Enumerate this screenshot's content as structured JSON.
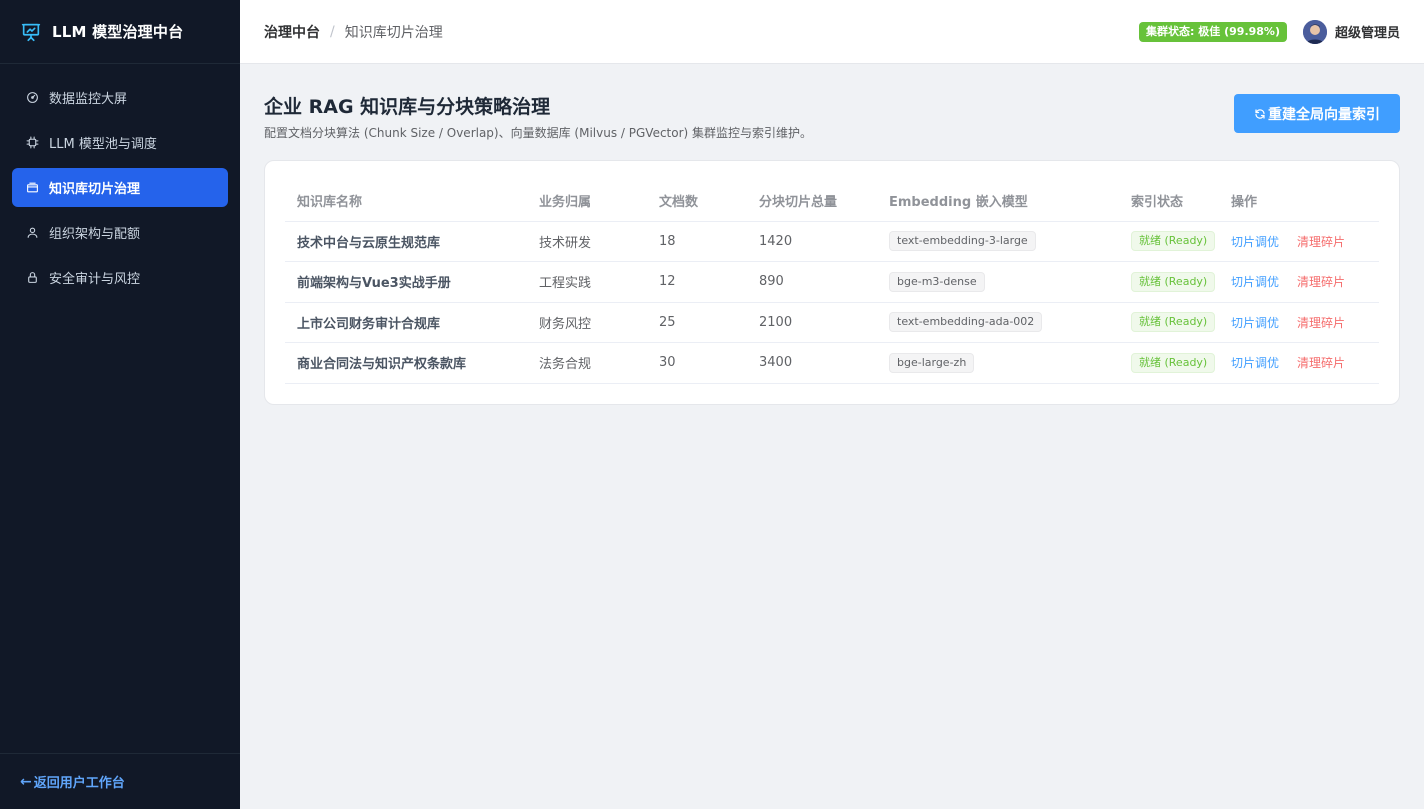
{
  "sidebar": {
    "brand": "LLM 模型治理中台",
    "items": [
      {
        "label": "数据监控大屏",
        "icon": "dashboard-icon",
        "active": false
      },
      {
        "label": "LLM 模型池与调度",
        "icon": "cpu-icon",
        "active": false
      },
      {
        "label": "知识库切片治理",
        "icon": "box-icon",
        "active": true
      },
      {
        "label": "组织架构与配额",
        "icon": "user-icon",
        "active": false
      },
      {
        "label": "安全审计与风控",
        "icon": "lock-icon",
        "active": false
      }
    ],
    "back_label": "返回用户工作台",
    "back_arrow": "←"
  },
  "header": {
    "breadcrumb_root": "治理中台",
    "breadcrumb_sep": "/",
    "breadcrumb_current": "知识库切片治理",
    "cluster_status": "集群状态: 极佳 (99.98%)",
    "user_name": "超级管理员"
  },
  "page": {
    "title": "企业 RAG 知识库与分块策略治理",
    "description": "配置文档分块算法 (Chunk Size / Overlap)、向量数据库 (Milvus / PGVector) 集群监控与索引维护。",
    "rebuild_button": "重建全局向量索引"
  },
  "table": {
    "columns": [
      "知识库名称",
      "业务归属",
      "文档数",
      "分块切片总量",
      "Embedding 嵌入模型",
      "索引状态",
      "操作"
    ],
    "rows": [
      {
        "name": "技术中台与云原生规范库",
        "dept": "技术研发",
        "docs": "18",
        "chunks": "1420",
        "model": "text-embedding-3-large",
        "status": "就绪 (Ready)"
      },
      {
        "name": "前端架构与Vue3实战手册",
        "dept": "工程实践",
        "docs": "12",
        "chunks": "890",
        "model": "bge-m3-dense",
        "status": "就绪 (Ready)"
      },
      {
        "name": "上市公司财务审计合规库",
        "dept": "财务风控",
        "docs": "25",
        "chunks": "2100",
        "model": "text-embedding-ada-002",
        "status": "就绪 (Ready)"
      },
      {
        "name": "商业合同法与知识产权条款库",
        "dept": "法务合规",
        "docs": "30",
        "chunks": "3400",
        "model": "bge-large-zh",
        "status": "就绪 (Ready)"
      }
    ],
    "op_tune": "切片调优",
    "op_clean": "清理碎片"
  },
  "colors": {
    "sidebar_bg": "#111827",
    "accent": "#2563eb",
    "primary": "#409eff",
    "success": "#67c23a",
    "danger": "#f56c6c"
  }
}
